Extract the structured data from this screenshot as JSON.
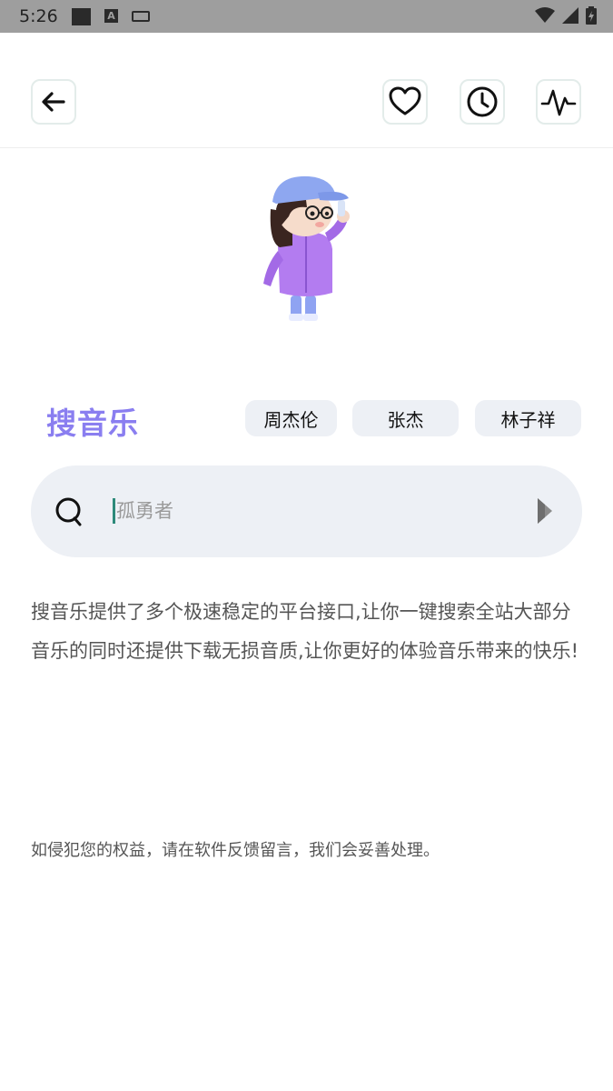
{
  "status_bar": {
    "time": "5:26",
    "icons": [
      "notification-square-icon",
      "a-icon",
      "keyboard-icon",
      "wifi-icon",
      "signal-icon",
      "battery-icon"
    ]
  },
  "topbar": {
    "icons": {
      "back": "back-arrow-icon",
      "favorite": "heart-icon",
      "history": "clock-icon",
      "activity": "waveform-icon"
    }
  },
  "main": {
    "title": "搜音乐",
    "hot_tags": [
      "周杰伦",
      "张杰",
      "林子祥"
    ],
    "search": {
      "placeholder": "孤勇者",
      "value": ""
    },
    "description": "搜音乐提供了多个极速稳定的平台接口,让你一键搜索全站大部分音乐的同时还提供下载无损音质,让你更好的体验音乐带来的快乐!",
    "notice": "如侵犯您的权益，请在软件反馈留言，我们会妥善处理。"
  },
  "colors": {
    "accent": "#8a7ef0",
    "chip_bg": "#edf0f5",
    "search_bg": "#edf0f5",
    "status_bar": "#9e9e9e"
  }
}
